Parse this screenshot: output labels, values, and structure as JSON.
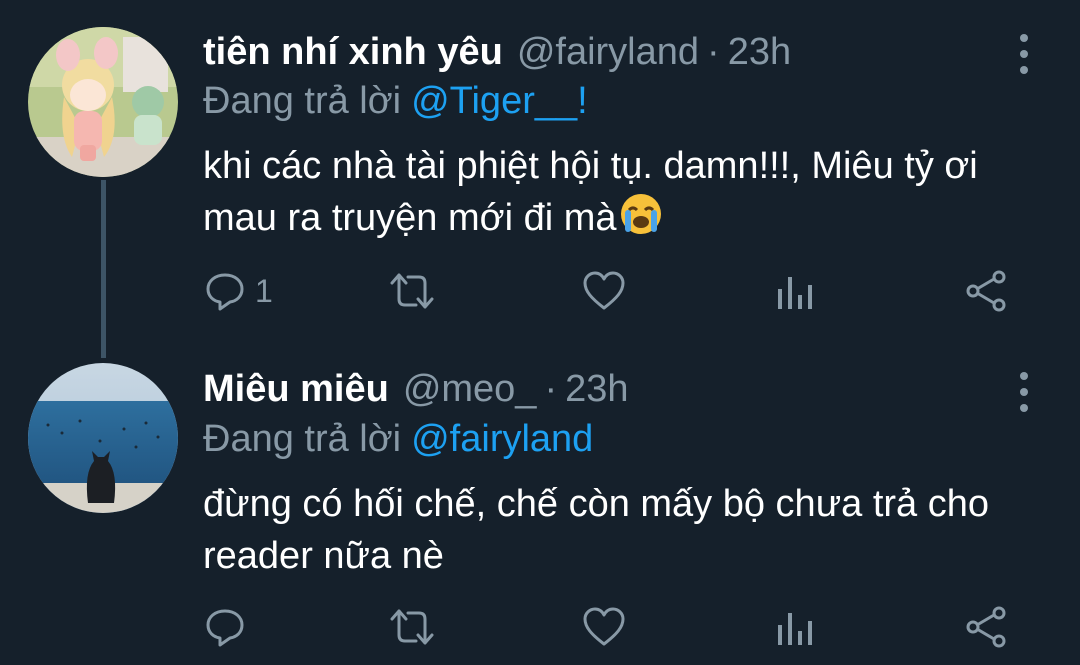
{
  "tweets": [
    {
      "display_name": "tiên nhí xinh yêu",
      "handle": "@fairyland",
      "separator": "·",
      "time": "23h",
      "reply_prefix": "Đang trả lời",
      "reply_to": "@Tiger__!",
      "text": "khi các nhà tài phiệt hội tụ. damn!!!, Miêu tỷ ơi mau ra truyện mới đi mà",
      "emoji": "loudly-crying-face",
      "reply_count": "1",
      "avatar": "figurine-photo"
    },
    {
      "display_name": "Miêu miêu",
      "handle": "@meo_",
      "separator": "·",
      "time": "23h",
      "reply_prefix": "Đang trả lời",
      "reply_to": "@fairyland",
      "text": "đừng có hối chế, chế còn mấy bộ chưa trả cho reader nữa nè",
      "reply_count": "",
      "avatar": "cat-by-sea-photo"
    }
  ],
  "icons": {
    "reply": "reply-icon",
    "retweet": "retweet-icon",
    "like": "heart-icon",
    "stats": "analytics-icon",
    "share": "share-icon",
    "more": "more-vertical-icon"
  },
  "colors": {
    "background": "#15202b",
    "text_primary": "#ffffff",
    "text_secondary": "#8899a6",
    "link": "#1da1f2",
    "thread_line": "#3d5466"
  }
}
